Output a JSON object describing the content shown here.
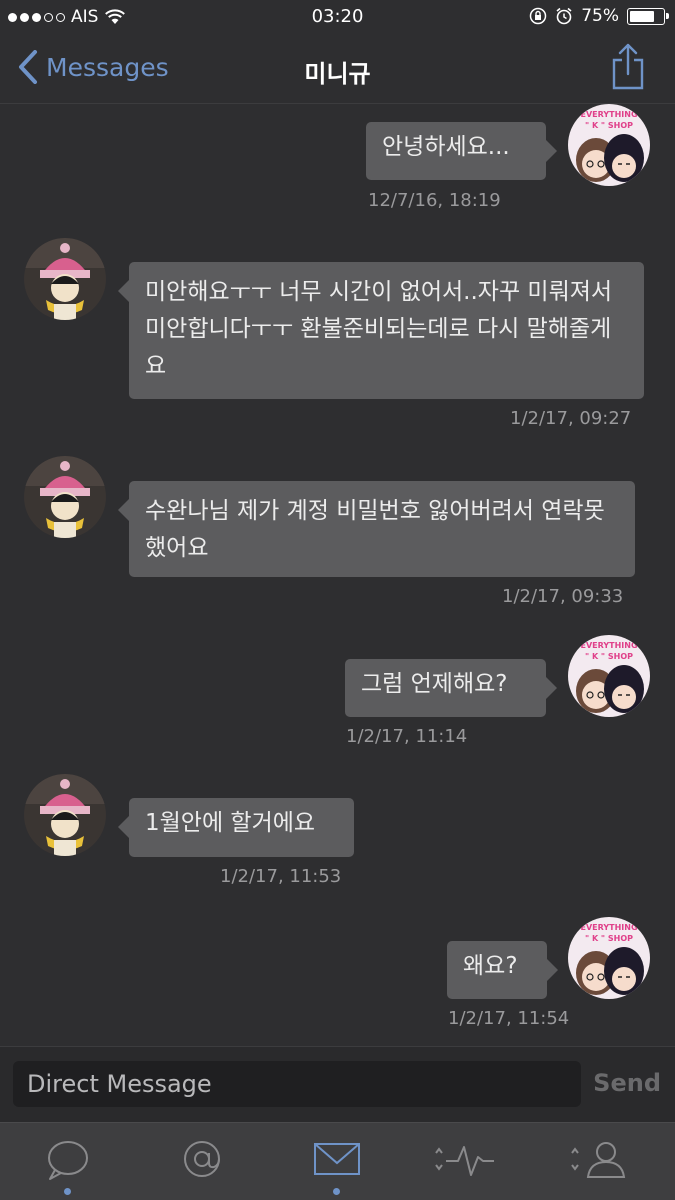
{
  "status_bar": {
    "carrier": "AIS",
    "time": "03:20",
    "battery_percent": "75%",
    "battery_level": 0.75
  },
  "nav": {
    "back_label": "Messages",
    "title": "미니규",
    "share_icon": "share-icon"
  },
  "messages": [
    {
      "direction": "out",
      "text": "안녕하세요...",
      "timestamp": "12/7/16, 18:19"
    },
    {
      "direction": "in",
      "text": "미안해요ㅜㅜ 너무 시간이 없어서..자꾸 미뤄져서 미안합니다ㅜㅜ 환불준비되는데로  다시 말해줄게요",
      "timestamp": "1/2/17, 09:27"
    },
    {
      "direction": "in",
      "text": "수완나님 제가 계정 비밀번호 잃어버려서 연락못했어요",
      "timestamp": "1/2/17, 09:33"
    },
    {
      "direction": "out",
      "text": "그럼 언제해요?",
      "timestamp": "1/2/17, 11:14"
    },
    {
      "direction": "in",
      "text": "1월안에 할거에요",
      "timestamp": "1/2/17, 11:53"
    },
    {
      "direction": "out",
      "text": "왜요?",
      "timestamp": "1/2/17, 11:54"
    }
  ],
  "outgoing_avatar_text": "EVERYTHING \" K \" SHOP",
  "composer": {
    "placeholder": "Direct Message",
    "send_label": "Send"
  },
  "tabs": [
    {
      "name": "timeline",
      "icon": "chat-bubble-icon",
      "active_dot": true
    },
    {
      "name": "mentions",
      "icon": "at-sign-icon",
      "active_dot": false
    },
    {
      "name": "messages",
      "icon": "envelope-icon",
      "active_dot": true
    },
    {
      "name": "activity",
      "icon": "activity-icon",
      "active_dot": false
    },
    {
      "name": "profile",
      "icon": "person-icon",
      "active_dot": false
    }
  ],
  "colors": {
    "accent": "#6f93c8",
    "background": "#2e2e30",
    "bubble": "#5c5c5e"
  }
}
